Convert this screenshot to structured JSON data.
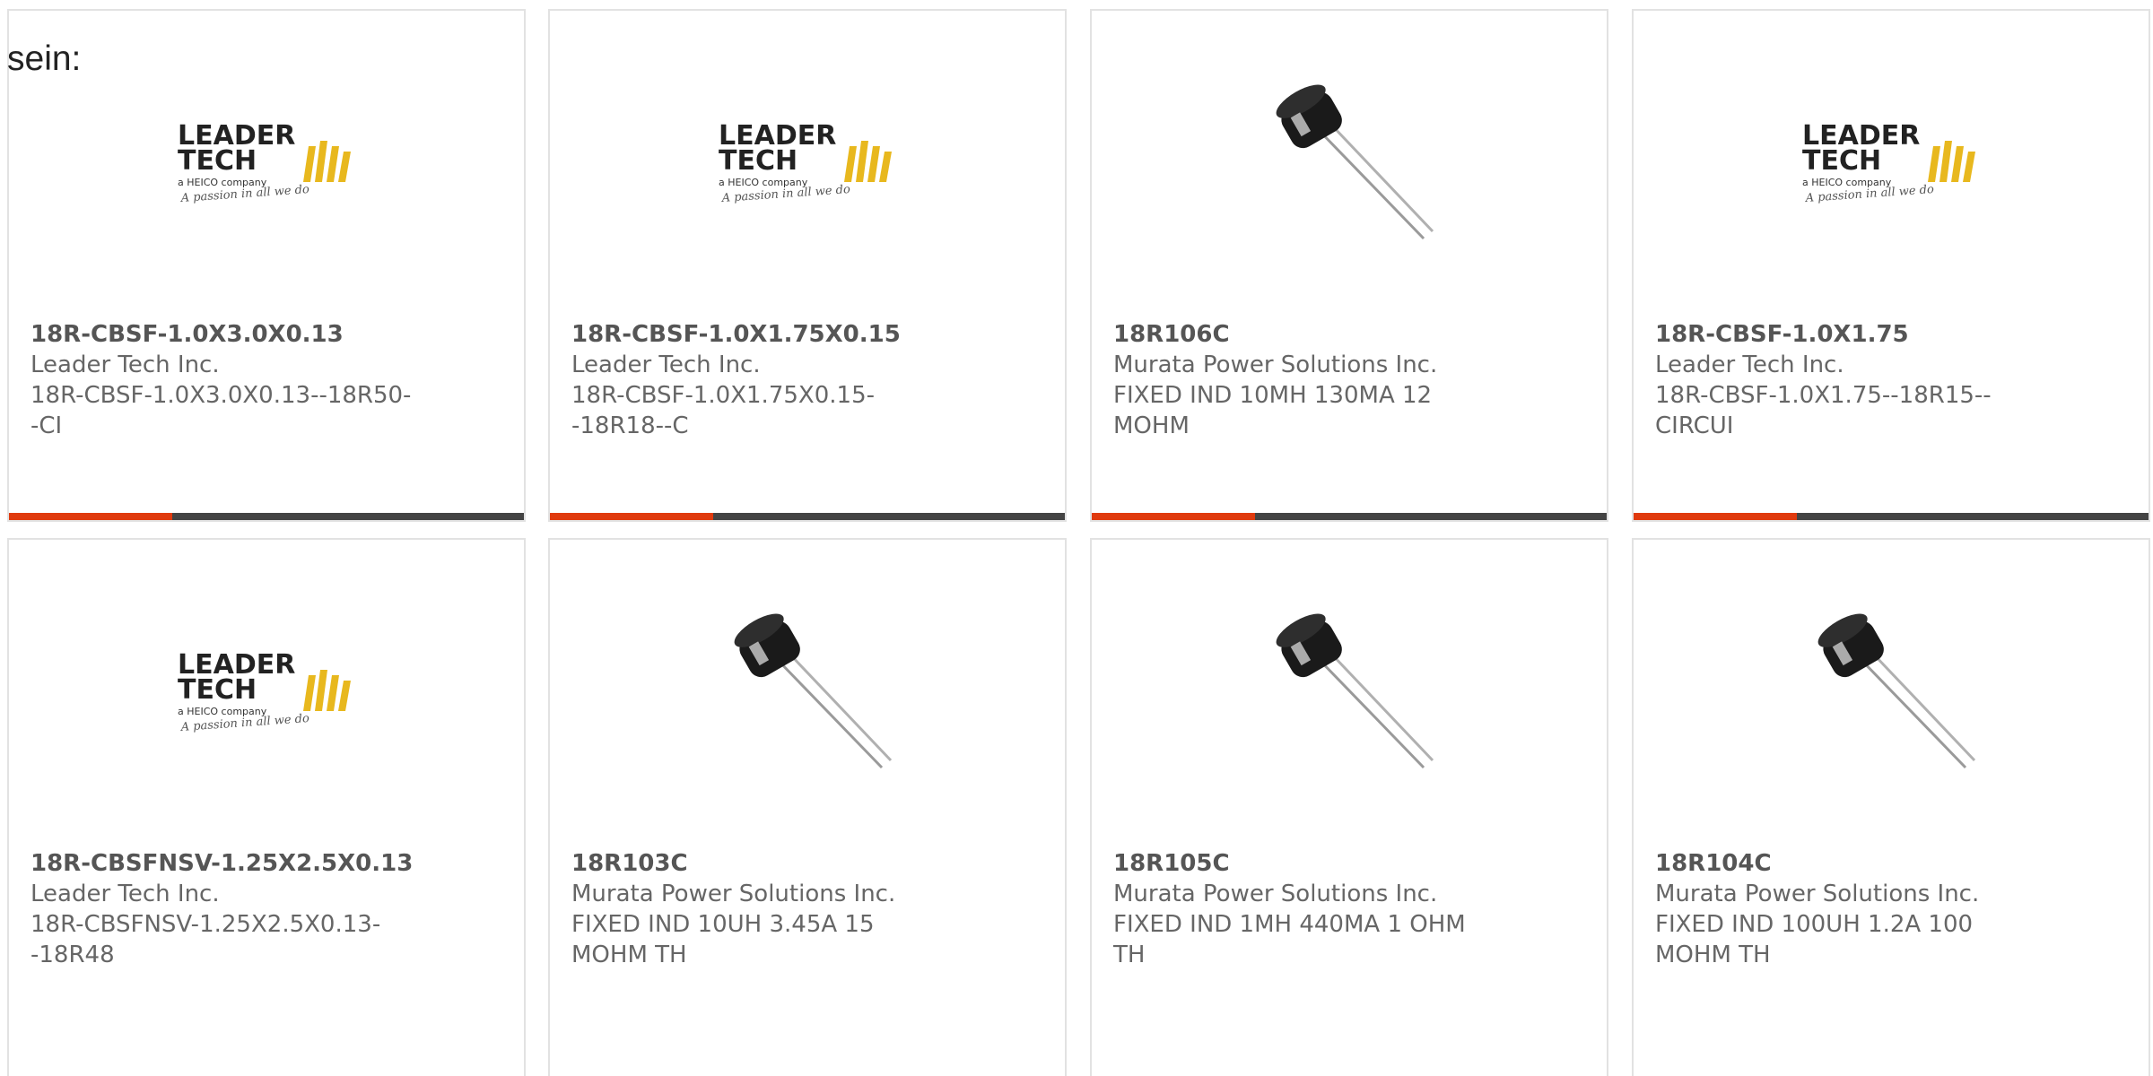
{
  "intro_text": "sein:",
  "products": [
    {
      "part_number": "18R-CBSF-1.0X3.0X0.13",
      "manufacturer": "Leader Tech Inc.",
      "description": "18R-CBSF-1.0X3.0X0.13--18R50--CI",
      "image": "leader-tech-logo",
      "logo_lines": [
        "LEADER",
        "TECH",
        "a HEICO company",
        "A passion in all we do"
      ]
    },
    {
      "part_number": "18R-CBSF-1.0X1.75X0.15",
      "manufacturer": "Leader Tech Inc.",
      "description": "18R-CBSF-1.0X1.75X0.15--18R18--C",
      "image": "leader-tech-logo",
      "logo_lines": [
        "LEADER",
        "TECH",
        "a HEICO company",
        "A passion in all we do"
      ]
    },
    {
      "part_number": "18R106C",
      "manufacturer": "Murata Power Solutions Inc.",
      "description": "FIXED IND 10MH 130MA 12 MOHM",
      "image": "radial-inductor-photo"
    },
    {
      "part_number": "18R-CBSF-1.0X1.75",
      "manufacturer": "Leader Tech Inc.",
      "description": "18R-CBSF-1.0X1.75--18R15--CIRCUI",
      "image": "leader-tech-logo",
      "logo_lines": [
        "LEADER",
        "TECH",
        "a HEICO company",
        "A passion in all we do"
      ]
    },
    {
      "part_number": "18R-CBSFNSV-1.25X2.5X0.13",
      "manufacturer": "Leader Tech Inc.",
      "description": "18R-CBSFNSV-1.25X2.5X0.13--18R48",
      "image": "leader-tech-logo",
      "logo_lines": [
        "LEADER",
        "TECH",
        "a HEICO company",
        "A passion in all we do"
      ]
    },
    {
      "part_number": "18R103C",
      "manufacturer": "Murata Power Solutions Inc.",
      "description": "FIXED IND 10UH 3.45A 15 MOHM TH",
      "image": "radial-inductor-photo"
    },
    {
      "part_number": "18R105C",
      "manufacturer": "Murata Power Solutions Inc.",
      "description": "FIXED IND 1MH 440MA 1 OHM TH",
      "image": "radial-inductor-photo"
    },
    {
      "part_number": "18R104C",
      "manufacturer": "Murata Power Solutions Inc.",
      "description": "FIXED IND 100UH 1.2A 100 MOHM TH",
      "image": "radial-inductor-photo"
    }
  ],
  "colors": {
    "accent_bar": "#e03a0e",
    "base_bar": "#444444",
    "logo_gold": "#e8b81e",
    "card_border": "#e2e2e2"
  }
}
